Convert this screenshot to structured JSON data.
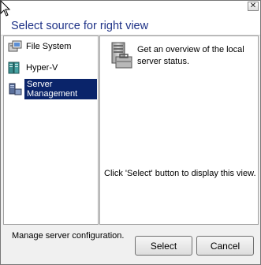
{
  "header": {
    "title": "Select source for right view"
  },
  "sources": [
    {
      "label": "File System",
      "icon": "file-system-icon"
    },
    {
      "label": "Hyper-V",
      "icon": "hyper-v-icon"
    },
    {
      "label": "Server Management",
      "icon": "server-management-icon",
      "selected": true
    }
  ],
  "details": {
    "description": "Get an overview of the local server status.",
    "hint": "Click 'Select' button to display this view."
  },
  "footer": {
    "status": "Manage server configuration.",
    "select_label": "Select",
    "cancel_label": "Cancel"
  },
  "colors": {
    "title": "#1e3287",
    "selection": "#0a246a"
  }
}
